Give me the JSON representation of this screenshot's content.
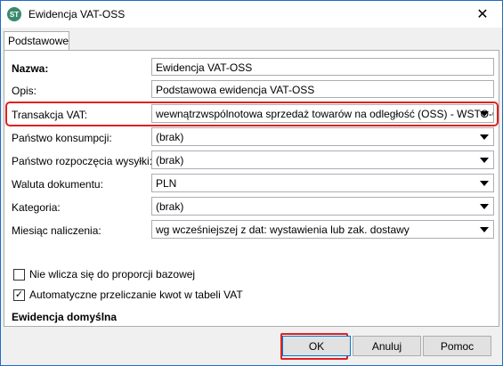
{
  "window": {
    "title": "Ewidencja VAT-OSS",
    "close_glyph": "✕",
    "app_icon_text": "ST"
  },
  "tabs": [
    {
      "label": "Podstawowe",
      "active": true
    }
  ],
  "form": {
    "nazwa": {
      "label": "Nazwa:",
      "value": "Ewidencja VAT-OSS"
    },
    "opis": {
      "label": "Opis:",
      "value": "Podstawowa ewidencja VAT-OSS"
    },
    "transakcja": {
      "label": "Transakcja VAT:",
      "value": "wewnątrzwspólnotowa sprzedaż towarów na odległość (OSS) - WSTO-OSS"
    },
    "panstwo_konsumpcji": {
      "label": "Państwo konsumpcji:",
      "value": "(brak)"
    },
    "panstwo_rozpoczecia": {
      "label": "Państwo rozpoczęcia wysyłki:",
      "value": "(brak)"
    },
    "waluta": {
      "label": "Waluta dokumentu:",
      "value": "PLN"
    },
    "kategoria": {
      "label": "Kategoria:",
      "value": "(brak)"
    },
    "miesiac": {
      "label": "Miesiąc naliczenia:",
      "value": "wg wcześniejszej z dat: wystawienia lub zak. dostawy"
    }
  },
  "checkboxes": {
    "proporcja": {
      "label": "Nie wlicza się do proporcji bazowej",
      "checked": false
    },
    "przeliczanie": {
      "label": "Automatyczne przeliczanie kwot w tabeli VAT",
      "checked": true,
      "mark": "✓"
    }
  },
  "section": {
    "ewidencja_domyslna": "Ewidencja domyślna"
  },
  "buttons": {
    "ok": "OK",
    "cancel": "Anuluj",
    "help": "Pomoc"
  },
  "colors": {
    "highlight": "#e02020",
    "accent": "#0078d7"
  }
}
